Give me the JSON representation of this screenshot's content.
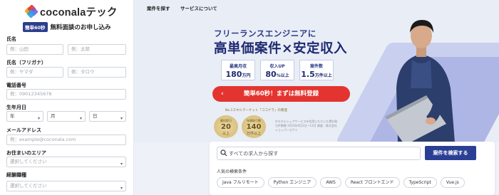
{
  "brand": {
    "name": "coconalaテック",
    "colors": {
      "navy": "#1e2a72",
      "red": "#e3342f",
      "button": "#2a3f94",
      "mark": [
        "#f5a623",
        "#e3342f",
        "#7b5cd6",
        "#2f9de4"
      ]
    }
  },
  "sidebar": {
    "cta_badge": "簡単60秒",
    "cta_text": "無料面談のお申し込み",
    "fields": {
      "name_label": "氏名",
      "last_name_placeholder": "例：山田",
      "first_name_placeholder": "例：太郎",
      "kana_label": "氏名（フリガナ）",
      "last_kana_placeholder": "例：ヤマダ",
      "first_kana_placeholder": "例：タロウ",
      "phone_label": "電話番号",
      "phone_placeholder": "例：09012345678",
      "birth_label": "生年月日",
      "year_suffix": "年",
      "month_suffix": "月",
      "day_suffix": "日",
      "email_label": "メールアドレス",
      "email_placeholder": "例：example@coconala.com",
      "area_label": "お住まいのエリア",
      "area_placeholder": "選択してください",
      "experience_label": "経験職種",
      "experience_placeholder": "選択してください"
    }
  },
  "nav": {
    "items": [
      "案件を探す",
      "サービスについて"
    ]
  },
  "hero": {
    "subtitle": "フリーランスエンジニアに",
    "title": "高単価案件×安定収入",
    "stats": [
      {
        "label": "最高月収",
        "value": "180",
        "unit": "万円"
      },
      {
        "label": "収入UP",
        "value": "80",
        "unit": "%以上"
      },
      {
        "label": "案件数",
        "value": "1.5",
        "unit": "万件以上"
      }
    ],
    "cta_button": "簡単60秒！まずは無料登録",
    "award_caption": "No.1スキルマーケット「ココナラ」の関連",
    "awards": [
      {
        "top": "最短即日",
        "num": "20",
        "unit": "以上"
      },
      {
        "top": "年間取引数",
        "num": "140",
        "unit": "万件以上"
      }
    ],
    "award_note": "※スキルシェアサービスを利用いただいた累計取引件数数 2023年9月1日〜12月 調査：株式会社ショッパーズアイ"
  },
  "search": {
    "placeholder": "すべての求人から探す",
    "button": "案件を検索する",
    "popular_label": "人気の検索条件",
    "chips": [
      "Java フルリモート",
      "Python エンジニア",
      "AWS",
      "React フロントエンド",
      "TypeScript",
      "Vue.js"
    ]
  }
}
